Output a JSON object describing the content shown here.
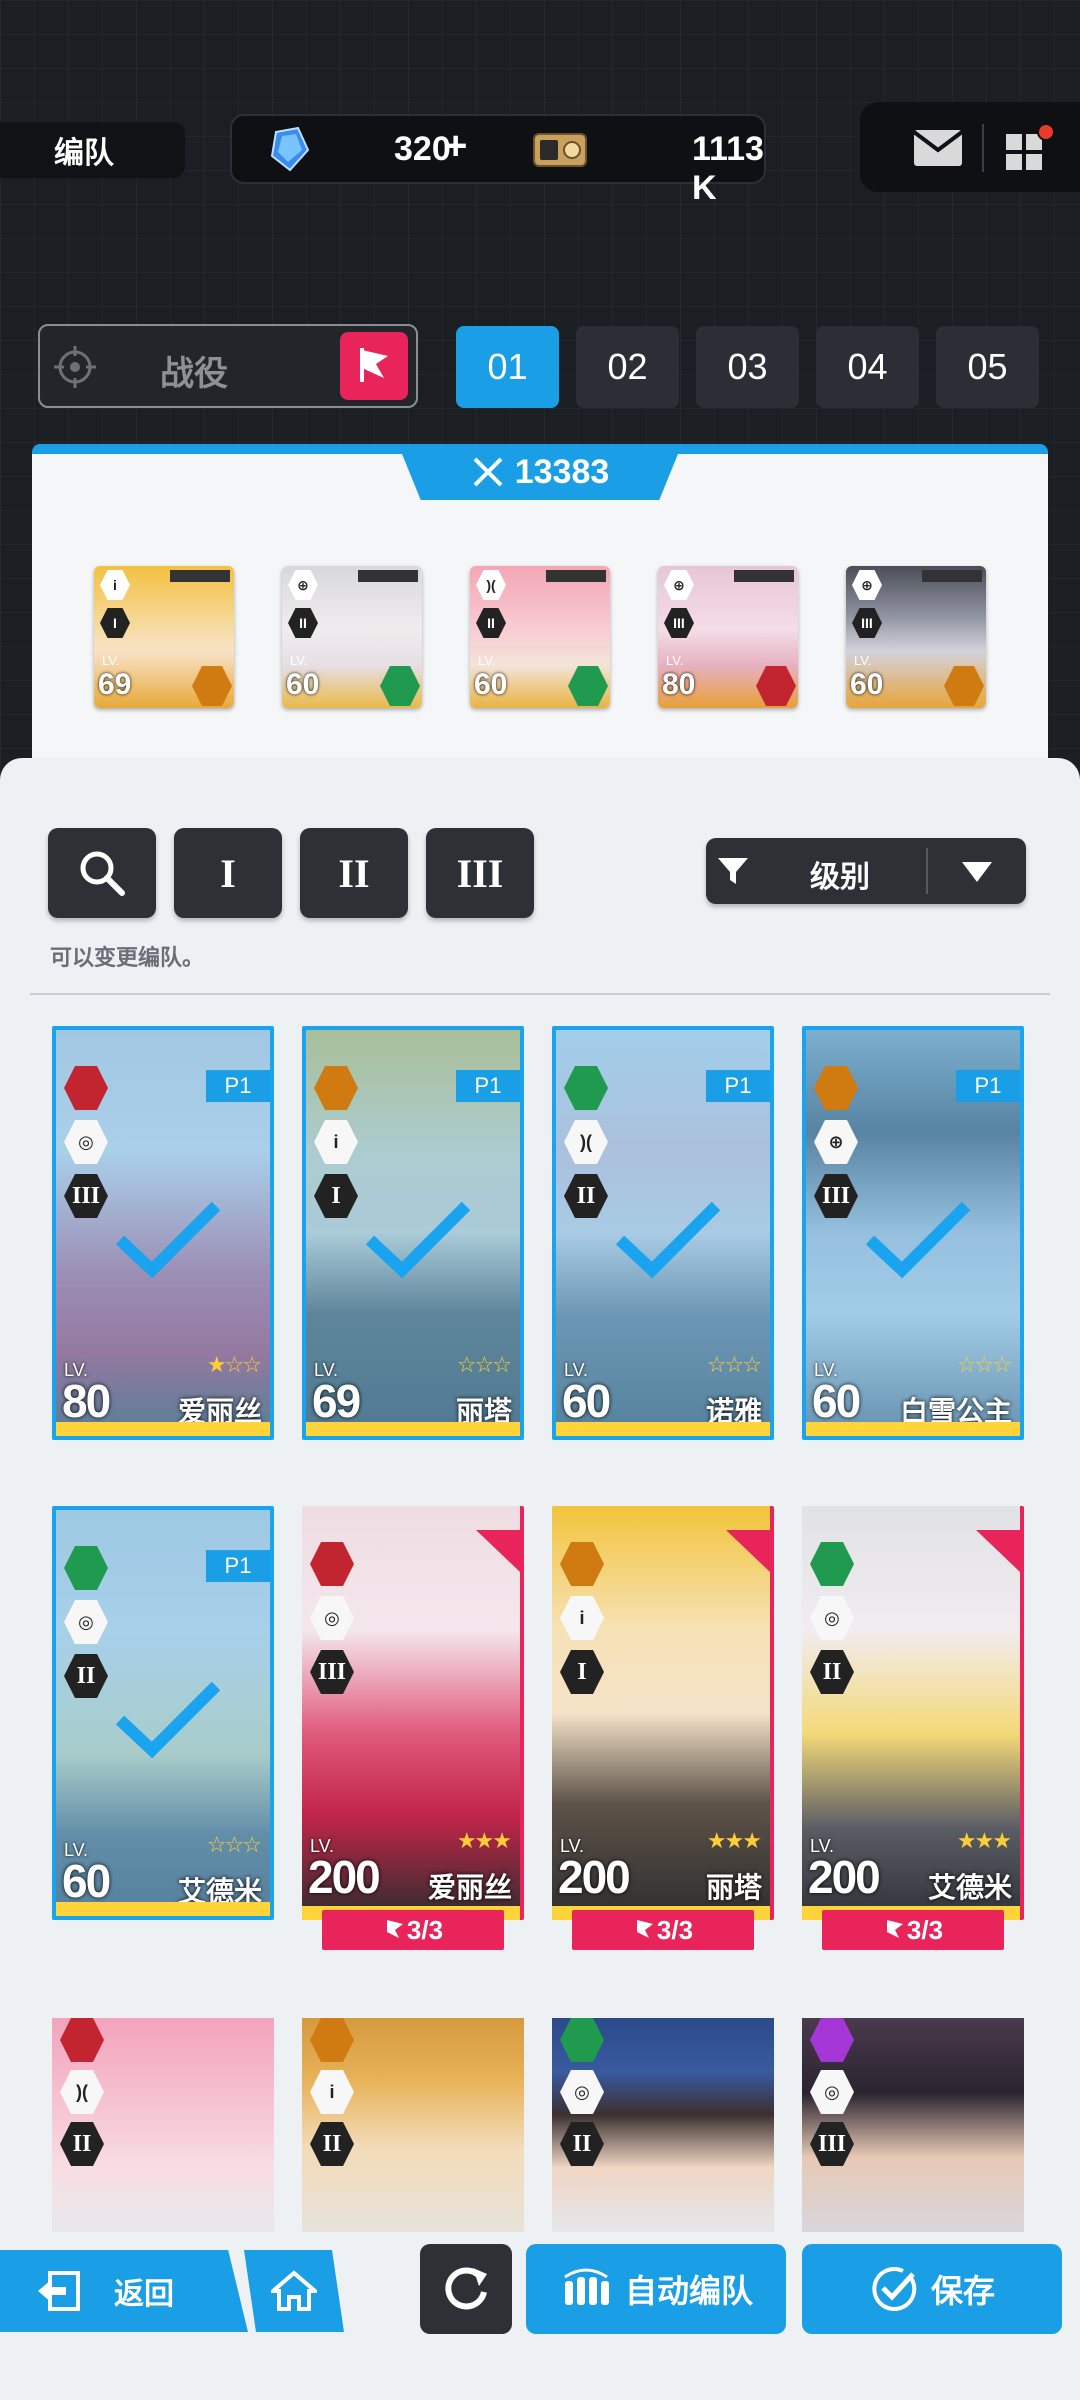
{
  "header": {
    "squad_label": "编队"
  },
  "currency": {
    "gems": "320",
    "plus": "+",
    "credits": "1113 K"
  },
  "campaign": {
    "label": "战役"
  },
  "squad_slots": [
    "01",
    "02",
    "03",
    "04",
    "05"
  ],
  "squad_slot_active": "01",
  "power": {
    "value": "13383"
  },
  "squad_members": [
    {
      "rank": "I",
      "level": "69",
      "element": "electric",
      "lv_label": "LV."
    },
    {
      "rank": "II",
      "level": "60",
      "element": "wind",
      "lv_label": "LV."
    },
    {
      "rank": "II",
      "level": "60",
      "element": "wind",
      "lv_label": "LV."
    },
    {
      "rank": "III",
      "level": "80",
      "element": "fire",
      "lv_label": "LV."
    },
    {
      "rank": "III",
      "level": "60",
      "element": "electric",
      "lv_label": "LV."
    }
  ],
  "filters": {
    "search_icon": "search-icon",
    "rank1": "I",
    "rank2": "II",
    "rank3": "III",
    "sort_label": "级别"
  },
  "hint": "可以变更编队。",
  "cards": [
    {
      "name": "爱丽丝",
      "level": "80",
      "rank": "III",
      "element": "fire",
      "selected": true,
      "tag": "P1"
    },
    {
      "name": "丽塔",
      "level": "69",
      "rank": "I",
      "element": "iron",
      "selected": true,
      "tag": "P1"
    },
    {
      "name": "诺雅",
      "level": "60",
      "rank": "II",
      "element": "wind",
      "selected": true,
      "tag": "P1"
    },
    {
      "name": "白雪公主",
      "level": "60",
      "rank": "III",
      "element": "iron",
      "selected": true,
      "tag": "P1"
    },
    {
      "name": "艾德米",
      "level": "60",
      "rank": "II",
      "element": "wind",
      "selected": true,
      "tag": "P1"
    },
    {
      "name": "爱丽丝",
      "level": "200",
      "rank": "III",
      "element": "fire",
      "selected": false,
      "campaign_count": "3/3"
    },
    {
      "name": "丽塔",
      "level": "200",
      "rank": "I",
      "element": "iron",
      "selected": false,
      "campaign_count": "3/3"
    },
    {
      "name": "艾德米",
      "level": "200",
      "rank": "II",
      "element": "wind",
      "selected": false,
      "campaign_count": "3/3"
    }
  ],
  "lv_label": "LV.",
  "partial_cards": [
    {
      "rank": "II",
      "element": "fire"
    },
    {
      "rank": "II",
      "element": "iron"
    },
    {
      "rank": "II",
      "element": "wind"
    },
    {
      "rank": "III",
      "element": "electric"
    }
  ],
  "bottom": {
    "back": "返回",
    "auto": "自动编队",
    "save": "保存"
  },
  "colors": {
    "accent": "#1a9ee6",
    "red": "#e8245a",
    "fire": "#c22530",
    "wind": "#1f9a4e",
    "iron": "#d07a12",
    "electric": "#a437d6"
  }
}
